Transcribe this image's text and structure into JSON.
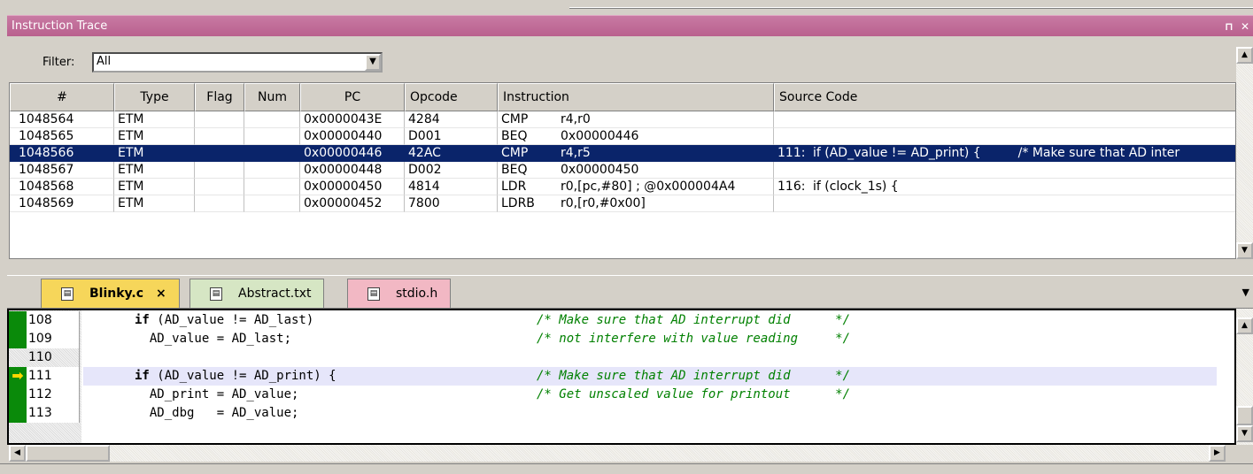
{
  "window": {
    "title": "Instruction Trace",
    "pin_glyph": "⊓",
    "close_glyph": "✕"
  },
  "filter": {
    "label": "Filter:",
    "value": "All"
  },
  "trace_table": {
    "columns": [
      "#",
      "Type",
      "Flag",
      "Num",
      "PC",
      "Opcode",
      "Instruction",
      "Source Code"
    ],
    "rows": [
      {
        "num": "1048564",
        "type": "ETM",
        "flag": "",
        "n": "",
        "pc": "0x0000043E",
        "opcode": "4284",
        "mnemonic": "CMP",
        "operands": "r4,r0",
        "src_line": "",
        "src_code": "",
        "src_comment": ""
      },
      {
        "num": "1048565",
        "type": "ETM",
        "flag": "",
        "n": "",
        "pc": "0x00000440",
        "opcode": "D001",
        "mnemonic": "BEQ",
        "operands": "0x00000446",
        "src_line": "",
        "src_code": "",
        "src_comment": ""
      },
      {
        "num": "1048566",
        "type": "ETM",
        "flag": "",
        "n": "",
        "pc": "0x00000446",
        "opcode": "42AC",
        "mnemonic": "CMP",
        "operands": "r4,r5",
        "src_line": "111:",
        "src_code": "if (AD_value != AD_print) {",
        "src_comment": "/* Make sure that AD inter"
      },
      {
        "num": "1048567",
        "type": "ETM",
        "flag": "",
        "n": "",
        "pc": "0x00000448",
        "opcode": "D002",
        "mnemonic": "BEQ",
        "operands": "0x00000450",
        "src_line": "",
        "src_code": "",
        "src_comment": ""
      },
      {
        "num": "1048568",
        "type": "ETM",
        "flag": "",
        "n": "",
        "pc": "0x00000450",
        "opcode": "4814",
        "mnemonic": "LDR",
        "operands": "r0,[pc,#80]  ; @0x000004A4",
        "src_line": "116:",
        "src_code": "if (clock_1s) {",
        "src_comment": ""
      },
      {
        "num": "1048569",
        "type": "ETM",
        "flag": "",
        "n": "",
        "pc": "0x00000452",
        "opcode": "7800",
        "mnemonic": "LDRB",
        "operands": "r0,[r0,#0x00]",
        "src_line": "",
        "src_code": "",
        "src_comment": ""
      }
    ],
    "selected_row": "1048566"
  },
  "tabs": [
    {
      "label": "Blinky.c",
      "close": "×",
      "active": true
    },
    {
      "label": "Abstract.txt",
      "active": false
    },
    {
      "label": "stdio.h",
      "active": false
    }
  ],
  "editor": {
    "lines": [
      {
        "num": "108",
        "code": "if (AD_value != AD_last)",
        "keyword": "if",
        "rest": " (AD_value != AD_last)",
        "comment": "/* Make sure that AD interrupt did      */"
      },
      {
        "num": "109",
        "code": "  AD_value = AD_last;",
        "keyword": "",
        "rest": "  AD_value = AD_last;",
        "comment": "/* not interfere with value reading     */"
      },
      {
        "num": "110",
        "code": "",
        "keyword": "",
        "rest": "",
        "comment": ""
      },
      {
        "num": "111",
        "code": "if (AD_value != AD_print) {",
        "keyword": "if",
        "rest": " (AD_value != AD_print) {",
        "comment": "/* Make sure that AD interrupt did      */",
        "current": true
      },
      {
        "num": "112",
        "code": "  AD_print = AD_value;",
        "keyword": "",
        "rest": "  AD_print = AD_value;",
        "comment": "/* Get unscaled value for printout      */"
      },
      {
        "num": "113",
        "code": "  AD_dbg   = AD_value;",
        "keyword": "",
        "rest": "  AD_dbg   = AD_value;",
        "comment": ""
      }
    ],
    "current_line": "111",
    "colors": {
      "breakpoint_bar": "#0a8a0a",
      "current_line_bg": "#e6e6fa",
      "comment": "#008000"
    }
  },
  "colors": {
    "titlebar": "#b9608e",
    "selection": "#0a246a"
  }
}
